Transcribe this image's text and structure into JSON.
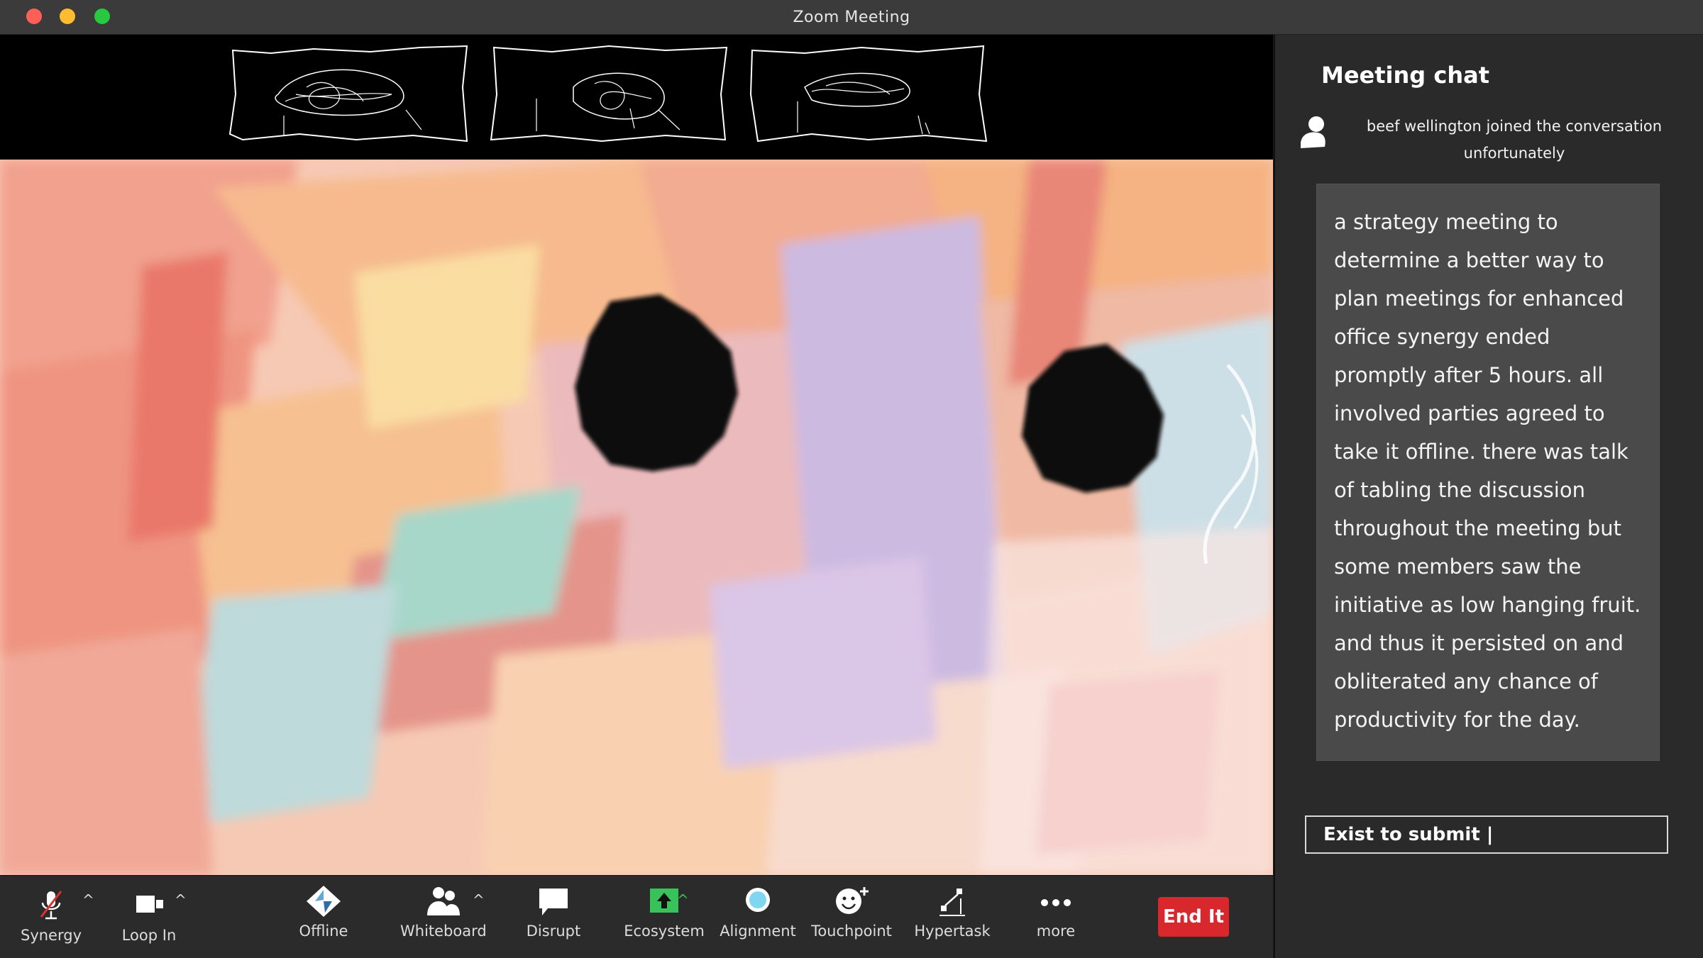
{
  "window": {
    "title": "Zoom Meeting"
  },
  "chat": {
    "title": "Meeting chat",
    "join_message": "beef wellington joined the conversation unfortunately",
    "message": "a strategy meeting to determine a better way to plan meetings for enhanced office synergy ended promptly after 5 hours. all involved parties agreed to take it offline. there was talk of tabling the discussion throughout the meeting but some members saw the initiative as low hanging fruit. and thus it persisted on and obliterated any chance of productivity for the day.",
    "input_placeholder": "Exist to submit |"
  },
  "toolbar": {
    "synergy_label": "Synergy",
    "loop_in_label": "Loop In",
    "offline_label": "Offline",
    "whiteboard_label": "Whiteboard",
    "disrupt_label": "Disrupt",
    "ecosystem_label": "Ecosystem",
    "alignment_label": "Alignment",
    "touchpoint_label": "Touchpoint",
    "hypertask_label": "Hypertask",
    "more_label": "more",
    "end_label": "End It"
  },
  "colors": {
    "end_button": "#d9272e",
    "ecosystem_green": "#39c25a",
    "alignment_blue": "#7fd6f0",
    "mic_muted_slash": "#e03030"
  }
}
